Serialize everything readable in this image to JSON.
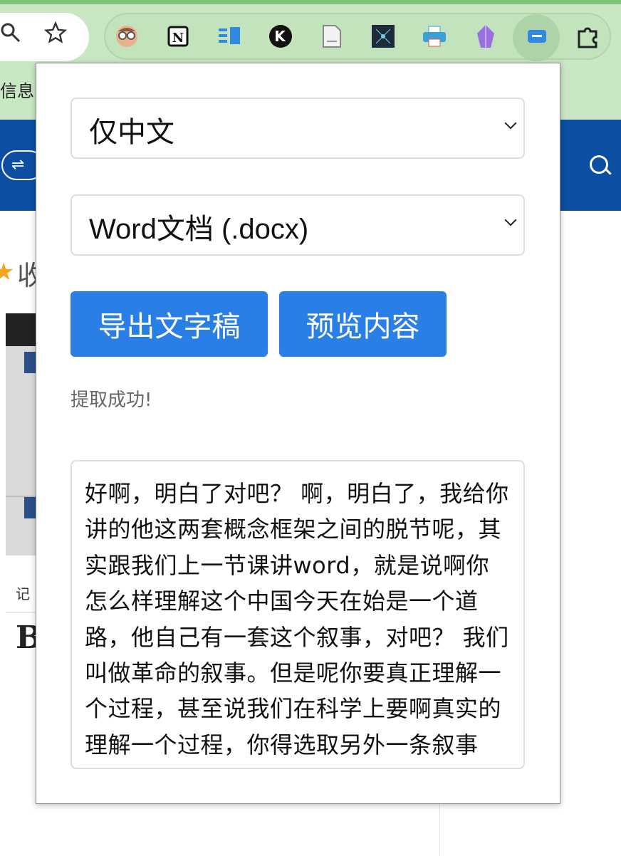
{
  "browser": {
    "bookmark_partial": "信息",
    "icons": {
      "search": "zoom-icon",
      "bookmark_star": "star-icon",
      "extensions": [
        "avatar-glasses-icon",
        "notion-icon",
        "blue-columns-icon",
        "k-circle-icon",
        "document-icon",
        "network-icon",
        "printer-icon",
        "crystal-icon",
        "transcript-extension-icon",
        "puzzle-icon"
      ]
    }
  },
  "page": {
    "swap_glyph": "⇌",
    "favorites_label": "收",
    "note_label": "记",
    "bold_label": "B"
  },
  "popup": {
    "language_select": {
      "value": "仅中文"
    },
    "format_select": {
      "value": "Word文档 (.docx)"
    },
    "export_button": "导出文字稿",
    "preview_button": "预览内容",
    "status": "提取成功!",
    "transcript": "好啊，明白了对吧？ 啊，明白了，我给你讲的他这两套概念框架之间的脱节呢，其实跟我们上一节课讲word，就是说啊你怎么样理解这个中国今天在始是一个道路，他自己有一套这个叙事，对吧？ 我们叫做革命的叙事。但是呢你要真正理解一个过程，甚至说我们在科学上要啊真实的理解一个过程，你得选取另外一条叙事啊，从"
  },
  "colors": {
    "chrome_green": "#c9e7c4",
    "page_blue": "#0b4ea2",
    "button_blue": "#2a7fe6"
  }
}
